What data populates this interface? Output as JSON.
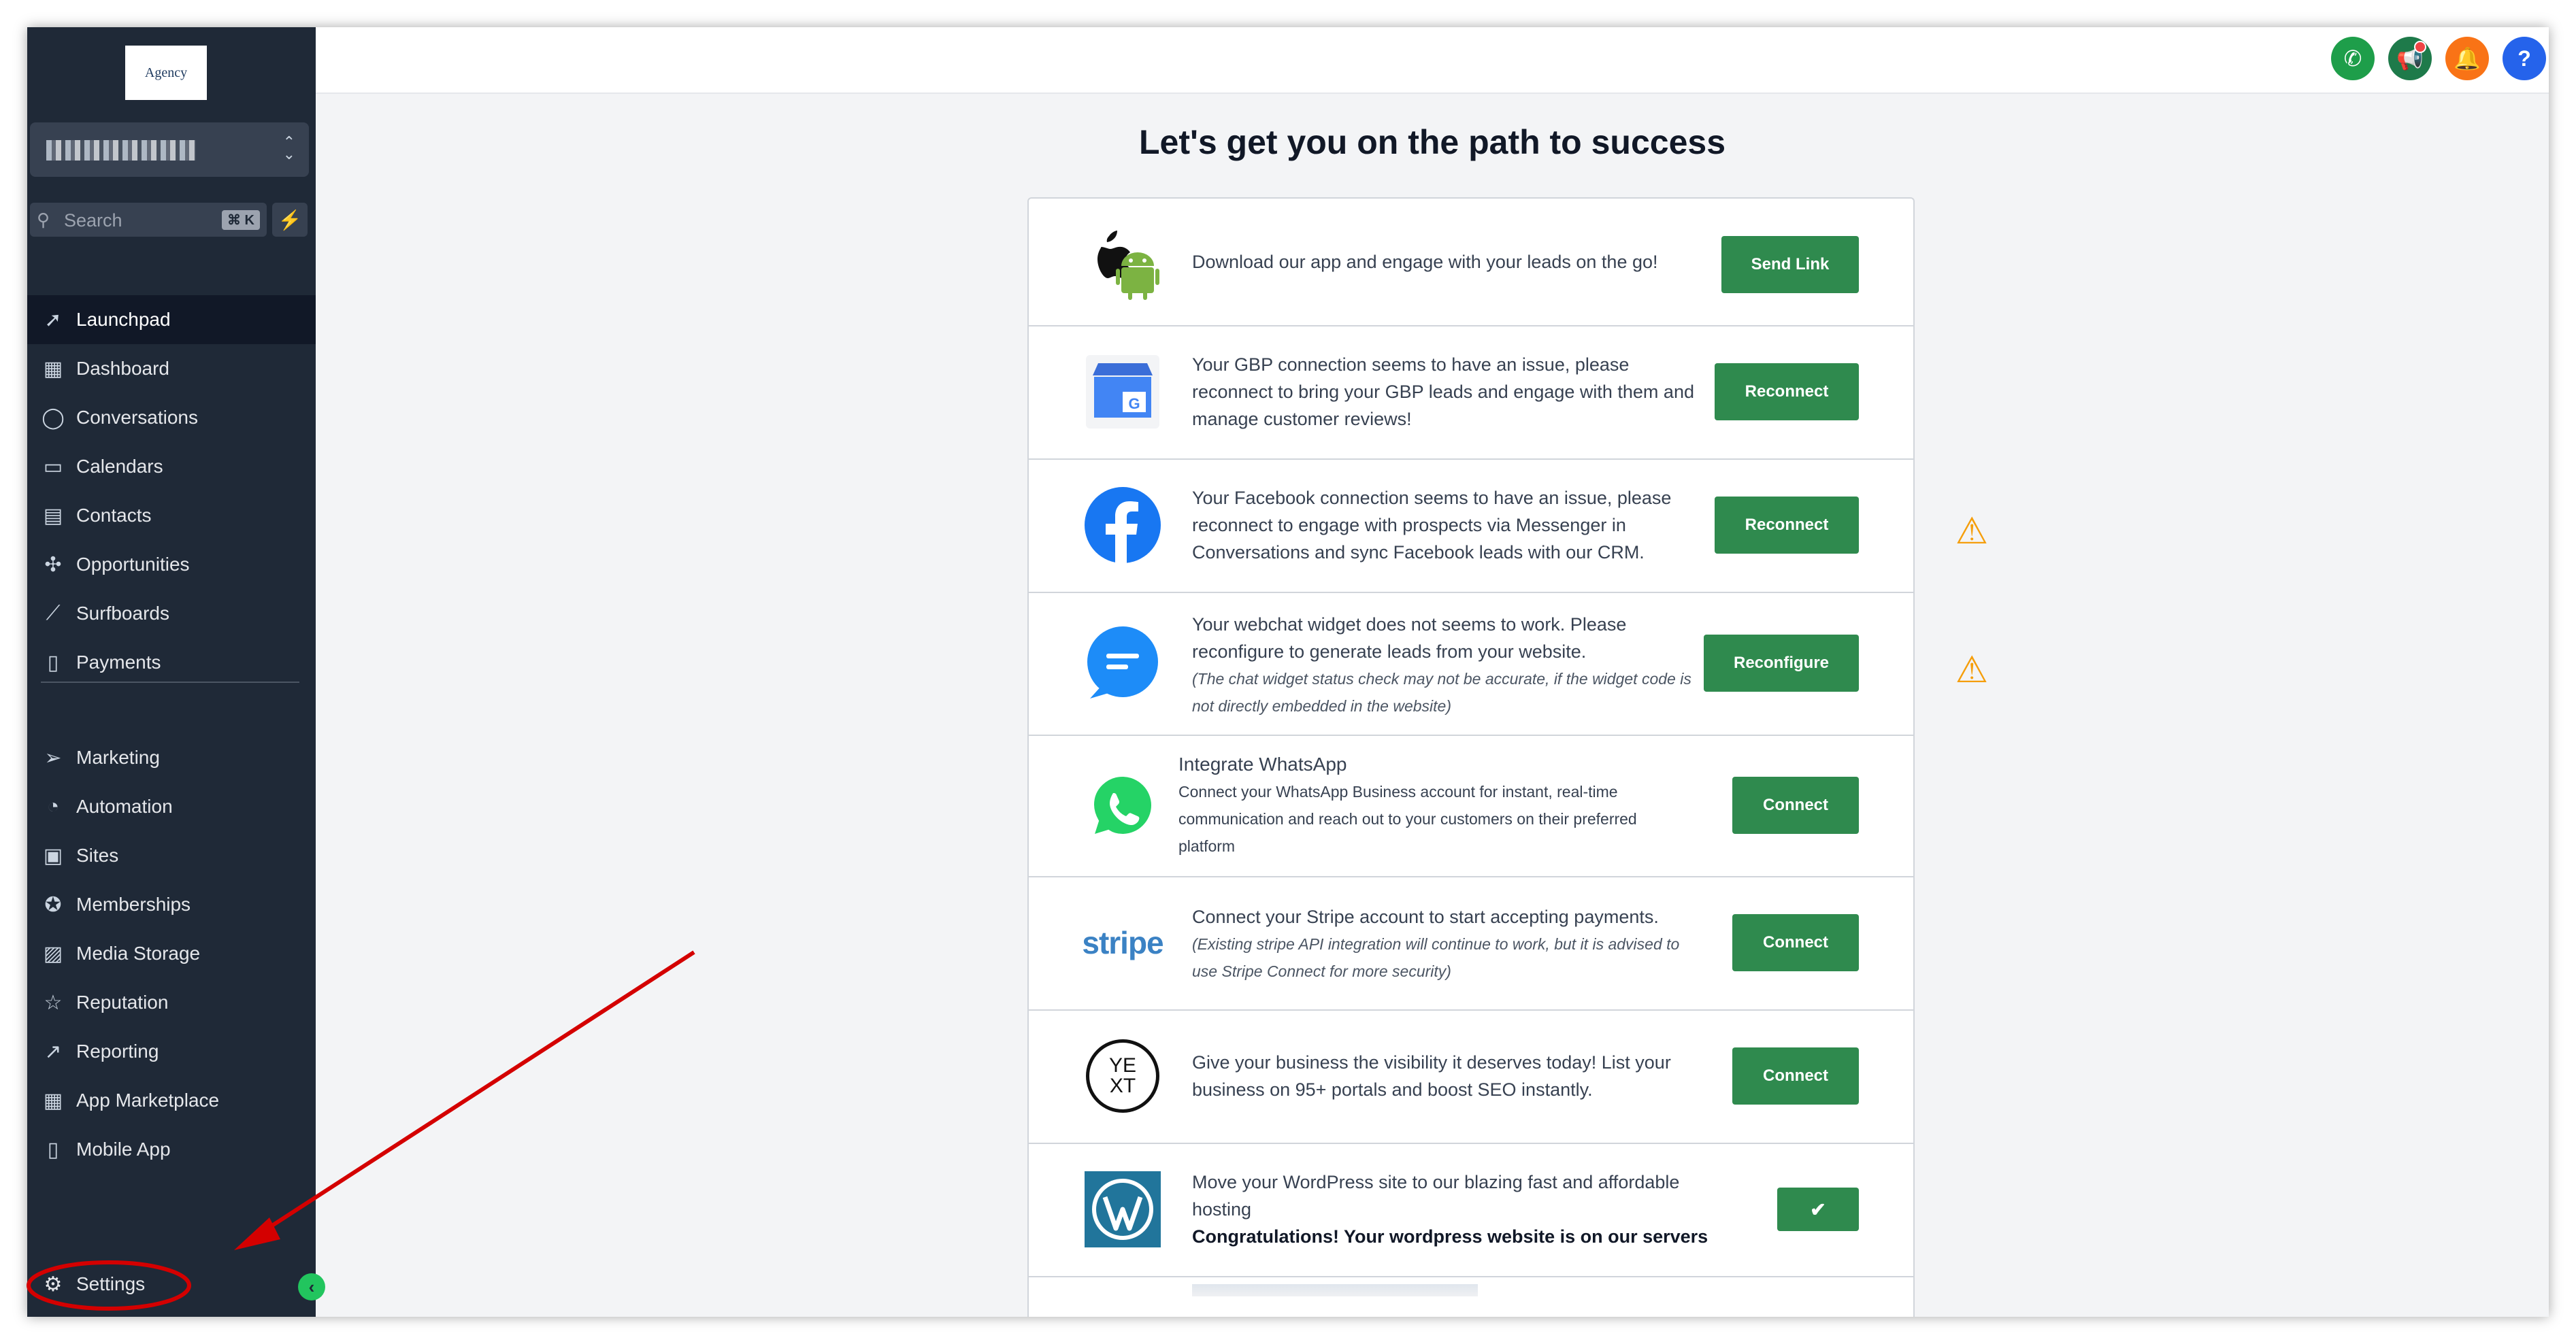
{
  "sidebar": {
    "logo_text": "Agency",
    "search_placeholder": "Search",
    "search_shortcut": "⌘ K",
    "items_primary": [
      {
        "label": "Launchpad",
        "icon": "rocket-icon",
        "active": true
      },
      {
        "label": "Dashboard",
        "icon": "grid-icon",
        "active": false
      },
      {
        "label": "Conversations",
        "icon": "chat-bubble-icon",
        "active": false
      },
      {
        "label": "Calendars",
        "icon": "calendar-icon",
        "active": false
      },
      {
        "label": "Contacts",
        "icon": "contact-book-icon",
        "active": false
      },
      {
        "label": "Opportunities",
        "icon": "network-icon",
        "active": false
      },
      {
        "label": "Surfboards",
        "icon": "surfboard-icon",
        "active": false
      },
      {
        "label": "Payments",
        "icon": "receipt-icon",
        "active": false
      }
    ],
    "items_secondary": [
      {
        "label": "Marketing",
        "icon": "send-icon"
      },
      {
        "label": "Automation",
        "icon": "automation-icon"
      },
      {
        "label": "Sites",
        "icon": "globe-icon"
      },
      {
        "label": "Memberships",
        "icon": "badge-icon"
      },
      {
        "label": "Media Storage",
        "icon": "image-icon"
      },
      {
        "label": "Reputation",
        "icon": "star-icon"
      },
      {
        "label": "Reporting",
        "icon": "trend-icon"
      },
      {
        "label": "App Marketplace",
        "icon": "apps-icon"
      },
      {
        "label": "Mobile App",
        "icon": "phone-icon"
      }
    ],
    "settings_label": "Settings"
  },
  "topbar": {
    "colors": {
      "phone": "#1e9e4a",
      "announce": "#1e7a4a",
      "bell": "#f97316",
      "help": "#2563eb"
    }
  },
  "main": {
    "heading": "Let's get you on the path to success",
    "rows": [
      {
        "text": "Download our app and engage with your leads on the go!",
        "button": "Send Link"
      },
      {
        "text": "Your GBP connection seems to have an issue, please reconnect to bring your GBP leads and engage with them and manage customer reviews!",
        "button": "Reconnect"
      },
      {
        "text": "Your Facebook connection seems to have an issue, please reconnect to engage with prospects via Messenger in Conversations and sync Facebook leads with our CRM.",
        "button": "Reconnect"
      },
      {
        "text": "Your webchat widget does not seems to work. Please reconfigure to generate leads from your website.",
        "note": "(The chat widget status check may not be accurate, if the widget code is not directly embedded in the website)",
        "button": "Reconfigure"
      },
      {
        "title": "Integrate WhatsApp",
        "text": "Connect your WhatsApp Business account for instant, real-time communication and reach out to your customers on their preferred platform",
        "button": "Connect"
      },
      {
        "text": "Connect your Stripe account to start accepting payments.",
        "note": "(Existing stripe API integration will continue to work, but it is advised to use Stripe Connect for more security)",
        "button": "Connect",
        "logo": "stripe"
      },
      {
        "text": "Give your business the visibility it deserves today! List your business on 95+ portals and boost SEO instantly.",
        "button": "Connect",
        "logo": "YE XT"
      },
      {
        "text": "Move your WordPress site to our blazing fast and affordable hosting",
        "bold": "Congratulations! Your wordpress website is on our servers",
        "button": "✔"
      }
    ]
  }
}
